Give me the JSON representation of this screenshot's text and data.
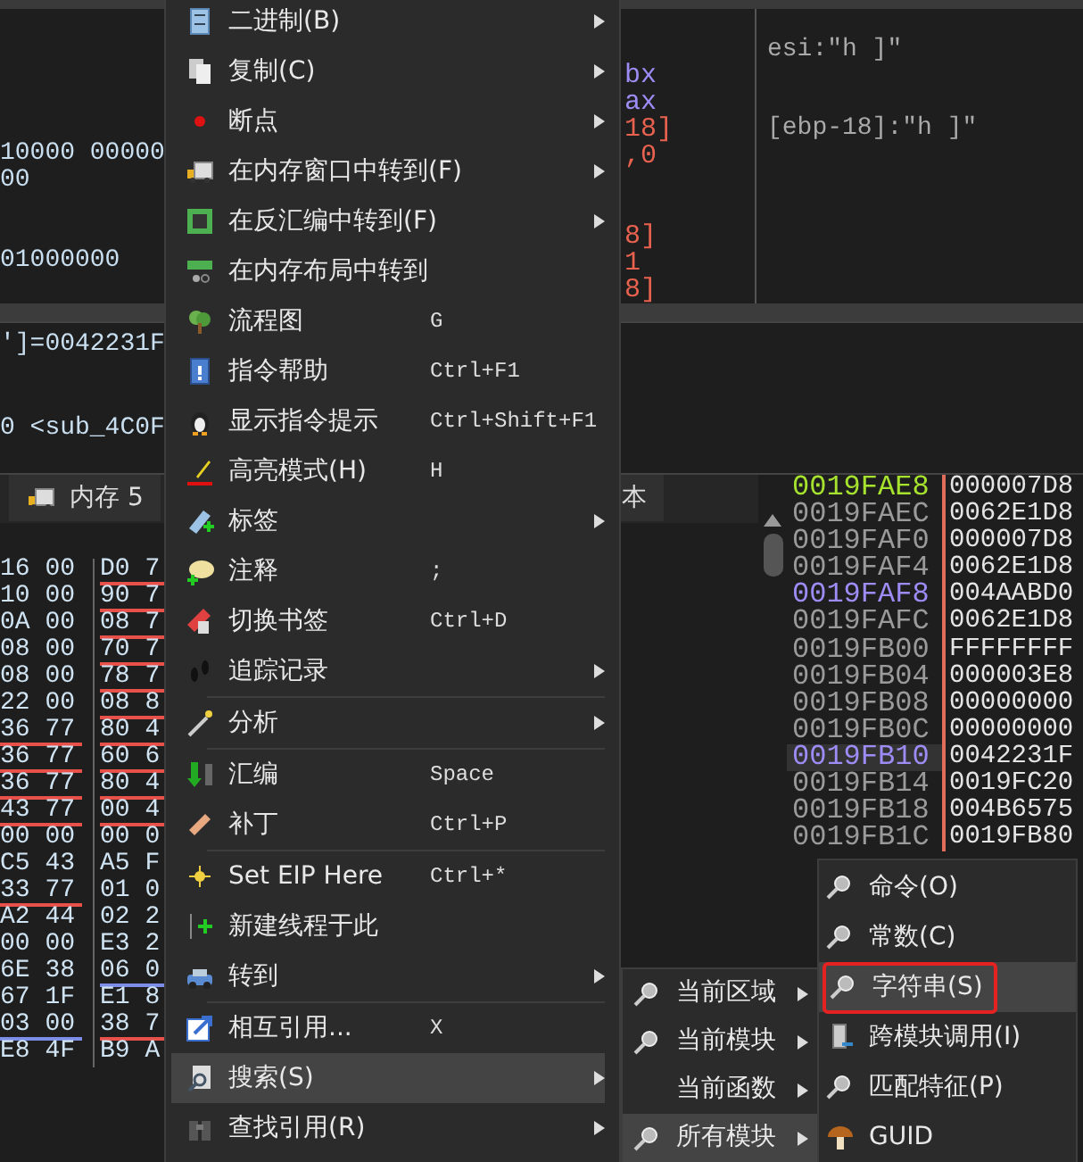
{
  "disassembly": {
    "lines": [
      {
        "text": "10000 00000"
      },
      {
        "text": "00"
      },
      {
        "text": "01000000"
      }
    ],
    "operand_fragments": [
      {
        "text": "bx",
        "color": "#9d8cf5"
      },
      {
        "text": "ax",
        "color": "#9d8cf5"
      },
      {
        "text": "18]",
        "color": "#e8624f"
      },
      {
        "text": ",0",
        "color": "#e8624f"
      },
      {
        "text": "8]",
        "color": "#e8624f"
      },
      {
        "text": "1",
        "color": "#e8624f"
      },
      {
        "text": "8]",
        "color": "#e8624f"
      }
    ]
  },
  "comments": [
    "esi:\"h ]\"",
    "[ebp-18]:\"h ]\""
  ],
  "info_lines": [
    "']=0042231F",
    "0 <sub_4C0F"
  ],
  "tabs": [
    {
      "label": "内存 5",
      "selected": false
    },
    {
      "label": "本",
      "selected": false
    }
  ],
  "hex_dump": [
    {
      "cells": [
        {
          "text": "16 00"
        },
        {
          "text": "D0 7",
          "color": "#e8504a"
        }
      ]
    },
    {
      "cells": [
        {
          "text": "10 00"
        },
        {
          "text": "90 7",
          "color": "#e8504a"
        }
      ]
    },
    {
      "cells": [
        {
          "text": "0A 00"
        },
        {
          "text": "08 7",
          "color": "#e8504a"
        }
      ]
    },
    {
      "cells": [
        {
          "text": "08 00"
        },
        {
          "text": "70 7",
          "color": "#e8504a"
        }
      ]
    },
    {
      "cells": [
        {
          "text": "08 00"
        },
        {
          "text": "78 7",
          "color": "#e8504a"
        }
      ]
    },
    {
      "cells": [
        {
          "text": "22 00"
        },
        {
          "text": "08 8",
          "color": "#e8504a"
        }
      ]
    },
    {
      "cells": [
        {
          "text": "36 77",
          "color": "#e8504a"
        },
        {
          "text": "80 4",
          "color": "#e8504a"
        }
      ]
    },
    {
      "cells": [
        {
          "text": "36 77",
          "color": "#e8504a"
        },
        {
          "text": "60 6",
          "color": "#e8504a"
        }
      ]
    },
    {
      "cells": [
        {
          "text": "36 77",
          "color": "#e8504a"
        },
        {
          "text": "80 4",
          "color": "#e8504a"
        }
      ]
    },
    {
      "cells": [
        {
          "text": "43 77",
          "color": "#e8504a"
        },
        {
          "text": "00 4",
          "color": "#e8504a"
        }
      ]
    },
    {
      "cells": [
        {
          "text": "00 00"
        },
        {
          "text": "00 0"
        }
      ]
    },
    {
      "cells": [
        {
          "text": "C5 43"
        },
        {
          "text": "A5 F"
        }
      ]
    },
    {
      "cells": [
        {
          "text": "33 77",
          "color": "#e8504a"
        },
        {
          "text": "01 0"
        }
      ]
    },
    {
      "cells": [
        {
          "text": "A2 44"
        },
        {
          "text": "02 2"
        }
      ]
    },
    {
      "cells": [
        {
          "text": "00 00"
        },
        {
          "text": "E3 2"
        }
      ]
    },
    {
      "cells": [
        {
          "text": "6E 38"
        },
        {
          "text": "06 0",
          "color": "#7c8ee8"
        }
      ]
    },
    {
      "cells": [
        {
          "text": "67 1F"
        },
        {
          "text": "E1 8"
        }
      ]
    },
    {
      "cells": [
        {
          "text": "03 00",
          "color": "#7c8ee8"
        },
        {
          "text": "38 7",
          "color": "#e8504a"
        }
      ]
    },
    {
      "cells": [
        {
          "text": "E8 4F"
        },
        {
          "text": "B9 A"
        }
      ]
    }
  ],
  "stack": [
    {
      "address": "0019FAE8",
      "value": "000007D8",
      "color": "#a6e22e",
      "selected": false
    },
    {
      "address": "0019FAEC",
      "value": "0062E1D8",
      "color": "#9a9a9a",
      "selected": false
    },
    {
      "address": "0019FAF0",
      "value": "000007D8",
      "color": "#9a9a9a",
      "selected": false
    },
    {
      "address": "0019FAF4",
      "value": "0062E1D8",
      "color": "#9a9a9a",
      "selected": false
    },
    {
      "address": "0019FAF8",
      "value": "004AABD0",
      "color": "#9d8cf5",
      "selected": false
    },
    {
      "address": "0019FAFC",
      "value": "0062E1D8",
      "color": "#9a9a9a",
      "selected": false
    },
    {
      "address": "0019FB00",
      "value": "FFFFFFFF",
      "color": "#9a9a9a",
      "selected": false
    },
    {
      "address": "0019FB04",
      "value": "000003E8",
      "color": "#9a9a9a",
      "selected": false
    },
    {
      "address": "0019FB08",
      "value": "00000000",
      "color": "#9a9a9a",
      "selected": false
    },
    {
      "address": "0019FB0C",
      "value": "00000000",
      "color": "#9a9a9a",
      "selected": false
    },
    {
      "address": "0019FB10",
      "value": "0042231F",
      "color": "#9d8cf5",
      "selected": true
    },
    {
      "address": "0019FB14",
      "value": "0019FC20",
      "color": "#9a9a9a",
      "selected": false
    },
    {
      "address": "0019FB18",
      "value": "004B6575",
      "color": "#9a9a9a",
      "selected": false
    },
    {
      "address": "0019FB1C",
      "value": "0019FB80",
      "color": "#9a9a9a",
      "selected": false
    }
  ],
  "context_menu": [
    {
      "kind": "item",
      "label": "二进制(B)",
      "has_submenu": true,
      "selected": false
    },
    {
      "kind": "item",
      "label": "复制(C)",
      "has_submenu": true,
      "selected": false
    },
    {
      "kind": "item",
      "label": "断点",
      "has_submenu": true,
      "selected": false
    },
    {
      "kind": "item",
      "label": "在内存窗口中转到(F)",
      "has_submenu": true,
      "selected": false
    },
    {
      "kind": "item",
      "label": "在反汇编中转到(F)",
      "has_submenu": true,
      "selected": false
    },
    {
      "kind": "item",
      "label": "在内存布局中转到",
      "has_submenu": false,
      "selected": false
    },
    {
      "kind": "item",
      "label": "流程图",
      "shortcut": "G",
      "has_submenu": false,
      "selected": false
    },
    {
      "kind": "item",
      "label": "指令帮助",
      "shortcut": "Ctrl+F1",
      "has_submenu": false,
      "selected": false
    },
    {
      "kind": "item",
      "label": "显示指令提示",
      "shortcut": "Ctrl+Shift+F1",
      "has_submenu": false,
      "selected": false
    },
    {
      "kind": "item",
      "label": "高亮模式(H)",
      "shortcut": "H",
      "has_submenu": false,
      "selected": false
    },
    {
      "kind": "item",
      "label": "标签",
      "has_submenu": true,
      "selected": false
    },
    {
      "kind": "item",
      "label": "注释",
      "shortcut": ";",
      "has_submenu": false,
      "selected": false
    },
    {
      "kind": "item",
      "label": "切换书签",
      "shortcut": "Ctrl+D",
      "has_submenu": false,
      "selected": false
    },
    {
      "kind": "item",
      "label": "追踪记录",
      "has_submenu": true,
      "selected": false
    },
    {
      "kind": "separator"
    },
    {
      "kind": "item",
      "label": "分析",
      "has_submenu": true,
      "selected": false
    },
    {
      "kind": "separator"
    },
    {
      "kind": "item",
      "label": "汇编",
      "shortcut": "Space",
      "has_submenu": false,
      "selected": false
    },
    {
      "kind": "item",
      "label": "补丁",
      "shortcut": "Ctrl+P",
      "has_submenu": false,
      "selected": false
    },
    {
      "kind": "separator"
    },
    {
      "kind": "item",
      "label": "Set EIP Here",
      "shortcut": "Ctrl+*",
      "has_submenu": false,
      "selected": false
    },
    {
      "kind": "item",
      "label": "新建线程于此",
      "has_submenu": false,
      "selected": false
    },
    {
      "kind": "item",
      "label": "转到",
      "has_submenu": true,
      "selected": false
    },
    {
      "kind": "separator"
    },
    {
      "kind": "item",
      "label": "相互引用...",
      "shortcut": "X",
      "has_submenu": false,
      "selected": false
    },
    {
      "kind": "item",
      "label": "搜索(S)",
      "has_submenu": true,
      "selected": true
    },
    {
      "kind": "item",
      "label": "查找引用(R)",
      "has_submenu": true,
      "selected": false
    }
  ],
  "search_submenu": [
    {
      "label": "当前区域",
      "has_submenu": true,
      "selected": false
    },
    {
      "label": "当前模块",
      "has_submenu": true,
      "selected": false
    },
    {
      "label": "当前函数",
      "has_submenu": true,
      "selected": false
    },
    {
      "label": "所有模块",
      "has_submenu": true,
      "selected": true
    }
  ],
  "module_submenu": [
    {
      "label": "命令(O)",
      "selected": false
    },
    {
      "label": "常数(C)",
      "selected": false
    },
    {
      "label": "字符串(S)",
      "selected": true,
      "annotated": true
    },
    {
      "label": "跨模块调用(I)",
      "selected": false
    },
    {
      "label": "匹配特征(P)",
      "selected": false
    },
    {
      "label": "GUID",
      "selected": false
    }
  ]
}
